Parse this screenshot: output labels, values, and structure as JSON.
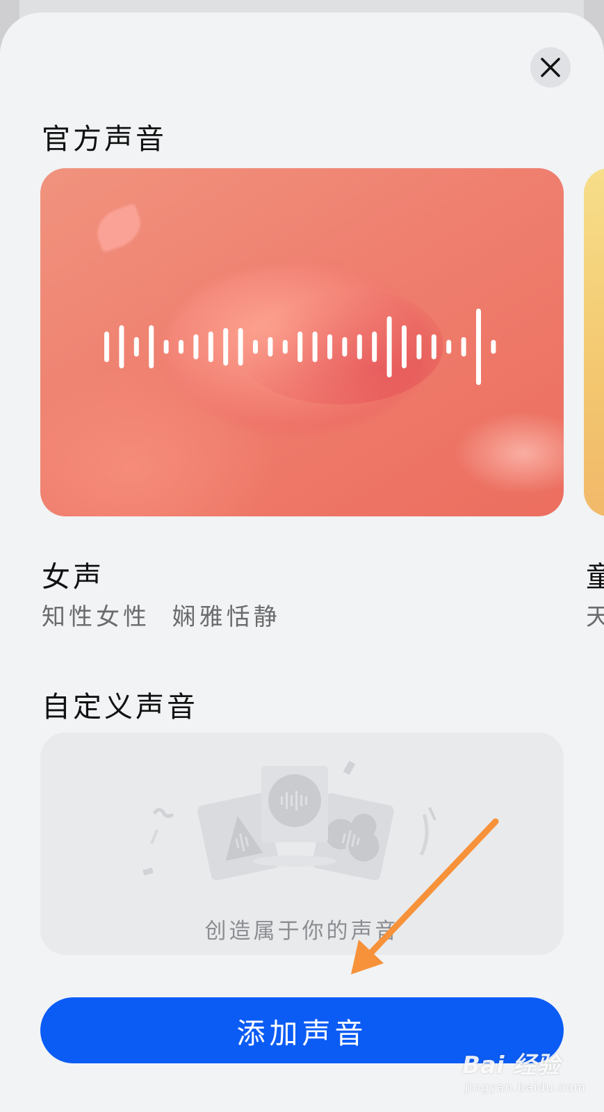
{
  "sections": {
    "official_title": "官方声音",
    "custom_title": "自定义声音"
  },
  "voice_cards": [
    {
      "name": "女声",
      "description": "知性女性  娴雅恬静",
      "theme_color": "#ef7f6f"
    },
    {
      "name": "童",
      "description": "天",
      "theme_color": "#f3c76f"
    }
  ],
  "custom_card": {
    "caption": "创造属于你的声音"
  },
  "add_button": {
    "label": "添加声音",
    "color": "#0b5cf5"
  },
  "close_icon": "close-icon",
  "annotation": {
    "color": "#f7923a"
  },
  "watermark": {
    "main": "Bai 经验",
    "sub": "jingyan.baidu.com"
  }
}
